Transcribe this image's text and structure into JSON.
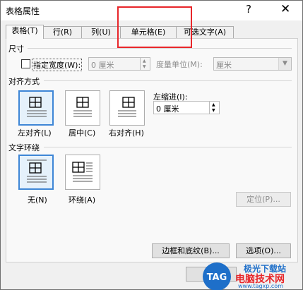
{
  "dialog": {
    "title": "表格属性",
    "help": "?",
    "close": "✕"
  },
  "tabs": [
    {
      "label": "表格(T)",
      "selected": true
    },
    {
      "label": "行(R)",
      "selected": false
    },
    {
      "label": "列(U)",
      "selected": false
    },
    {
      "label": "单元格(E)",
      "selected": false
    },
    {
      "label": "可选文字(A)",
      "selected": false
    }
  ],
  "size": {
    "section": "尺寸",
    "specify_width_label": "指定宽度(W):",
    "specify_width_checked": false,
    "width_value": "0 厘米",
    "unit_label": "度量单位(M):",
    "unit_value": "厘米"
  },
  "alignment": {
    "section": "对齐方式",
    "options": [
      {
        "label": "左对齐(L)",
        "selected": true
      },
      {
        "label": "居中(C)",
        "selected": false
      },
      {
        "label": "右对齐(H)",
        "selected": false
      }
    ],
    "indent_label": "左缩进(I):",
    "indent_value": "0 厘米"
  },
  "wrapping": {
    "section": "文字环绕",
    "options": [
      {
        "label": "无(N)",
        "selected": true
      },
      {
        "label": "环绕(A)",
        "selected": false
      }
    ],
    "position_button": "定位(P)..."
  },
  "buttons": {
    "borders": "边框和底纹(B)...",
    "options": "选项(O)..."
  },
  "watermark": {
    "logo": "TAG",
    "site_name": "电脑技术网",
    "url": "www.tagxp.com",
    "top_text": "极光下载站"
  },
  "colors": {
    "highlight": "#e8262a",
    "selection": "#3e86d6"
  }
}
